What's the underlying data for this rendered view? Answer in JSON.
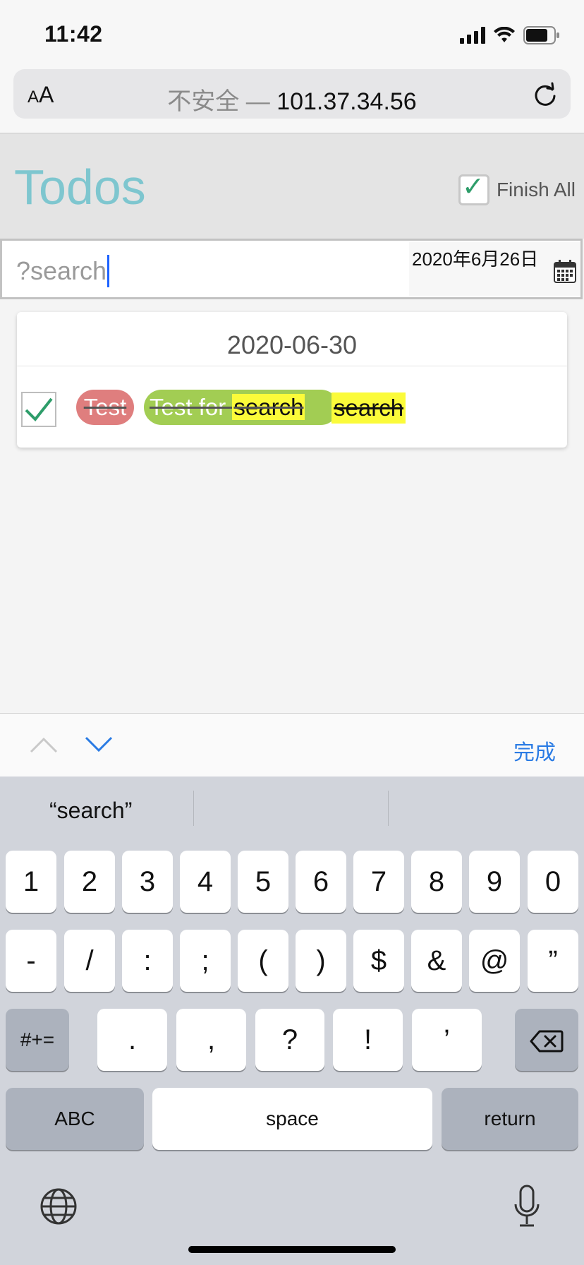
{
  "status_bar": {
    "time": "11:42"
  },
  "browser": {
    "aa_label_small": "A",
    "aa_label_large": "A",
    "url_insecure": "不安全 — ",
    "url_host": "101.37.34.56"
  },
  "app": {
    "title": "Todos",
    "finish_all_label": "Finish All",
    "finish_all_checked": true
  },
  "search": {
    "value": "?search",
    "date_value": "2020年6月26日"
  },
  "todo_group": {
    "date": "2020-06-30",
    "item": {
      "checked": true,
      "tags": [
        {
          "text": "Test",
          "color": "#df7e7e"
        },
        {
          "text_prefix": "Test for ",
          "text_match": "search",
          "color": "#a2cd53"
        },
        {
          "text": "search",
          "color": "#fbfb3a"
        }
      ]
    }
  },
  "accessory": {
    "done_label": "完成"
  },
  "keyboard": {
    "suggestion": "“search”",
    "row1": [
      "1",
      "2",
      "3",
      "4",
      "5",
      "6",
      "7",
      "8",
      "9",
      "0"
    ],
    "row2": [
      "-",
      "/",
      ":",
      ";",
      "(",
      ")",
      "$",
      "&",
      "@",
      "”"
    ],
    "row3": [
      "#+=",
      ".",
      ",",
      "?",
      "!",
      "’"
    ],
    "abc_label": "ABC",
    "space_label": "space",
    "return_label": "return"
  },
  "colors": {
    "accent": "#7ec6cf",
    "link_blue": "#2a7be4",
    "check_green": "#2e9d6a",
    "highlight": "#fbfb3a"
  }
}
